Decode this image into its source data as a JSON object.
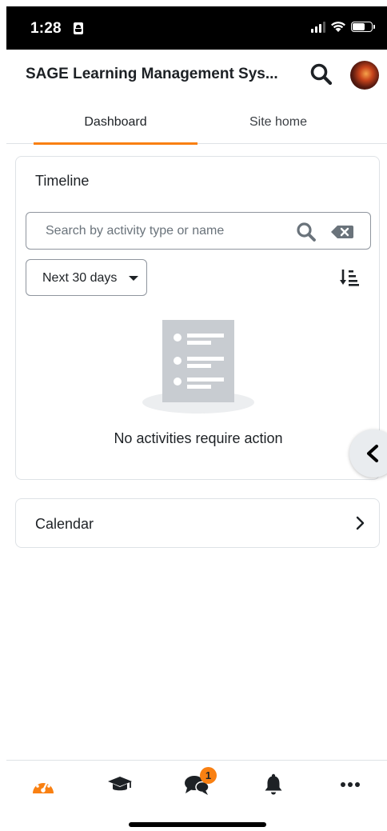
{
  "status_bar": {
    "time": "1:28"
  },
  "header": {
    "title": "SAGE Learning Management Sys..."
  },
  "tabs": [
    {
      "label": "Dashboard",
      "active": true
    },
    {
      "label": "Site home",
      "active": false
    }
  ],
  "timeline": {
    "title": "Timeline",
    "search_placeholder": "Search by activity type or name",
    "filter_selected": "Next 30 days",
    "empty_message": "No activities require action"
  },
  "calendar": {
    "title": "Calendar"
  },
  "bottom_nav": {
    "items": [
      {
        "icon": "dashboard-icon",
        "active": true
      },
      {
        "icon": "graduation-cap-icon",
        "active": false
      },
      {
        "icon": "messages-icon",
        "active": false,
        "badge": "1"
      },
      {
        "icon": "bell-icon",
        "active": false
      },
      {
        "icon": "more-icon",
        "active": false
      }
    ]
  },
  "colors": {
    "accent": "#f98012",
    "text": "#1d2125",
    "border": "#dee2e6",
    "illustration": "#c8ccd1"
  }
}
